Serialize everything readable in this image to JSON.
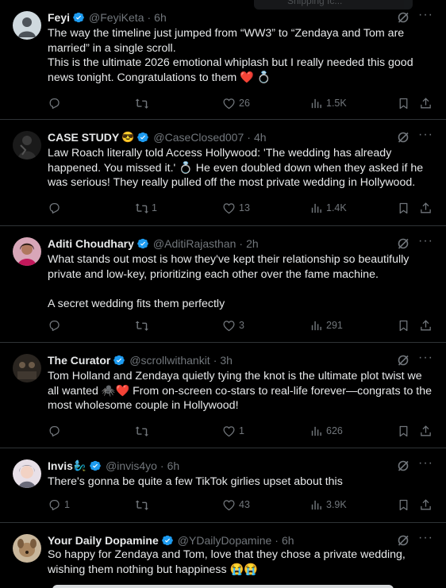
{
  "colors": {
    "background": "#000000",
    "text": "#e7e9ea",
    "muted": "#71767b",
    "verified": "#1d9bf0",
    "divider": "#2f3336",
    "heart_emoji": "#e0245e"
  },
  "top_overlay": {
    "text": "Shipping Ic..."
  },
  "tweets": [
    {
      "name": "Feyi",
      "name_emoji": "",
      "handle": "@FeyiKeta",
      "time": "6h",
      "text_lines": [
        "The way the timeline just jumped from “WW3” to “Zendaya and Tom are married” in a single scroll.",
        "This is the ultimate 2026 emotional whiplash but I really needed this good news tonight. Congratulations to them ❤️ 💍"
      ],
      "replies": "",
      "reposts": "",
      "likes": "26",
      "views": "1.5K",
      "avatar_icon": "default-profile-avatar"
    },
    {
      "name": "CASE STUDY",
      "name_emoji": "😎",
      "handle": "@CaseClosed007",
      "time": "4h",
      "text_lines": [
        "Law Roach literally told Access Hollywood: 'The wedding has already happened. You missed it.' 💍 He even doubled down when they asked if he was serious! They really pulled off the most private wedding in Hollywood."
      ],
      "replies": "",
      "reposts": "1",
      "likes": "13",
      "views": "1.4K",
      "avatar_icon": "dark-figure-avatar"
    },
    {
      "name": "Aditi Choudhary",
      "name_emoji": "",
      "handle": "@AditiRajasthan",
      "time": "2h",
      "text_lines": [
        "What stands out most is how they've kept their relationship so beautifully private and low-key, prioritizing each other over the fame machine.",
        "",
        "A secret wedding fits them perfectly"
      ],
      "replies": "",
      "reposts": "",
      "likes": "3",
      "views": "291",
      "avatar_icon": "woman-avatar"
    },
    {
      "name": "The Curator",
      "name_emoji": "",
      "handle": "@scrollwithankit",
      "time": "3h",
      "text_lines": [
        "Tom Holland and Zendaya quietly tying the knot is the ultimate plot twist we all wanted 🕷️❤️ From on-screen co-stars to real-life forever—congrats to the most wholesome couple in Hollywood!"
      ],
      "replies": "",
      "reposts": "",
      "likes": "1",
      "views": "626",
      "avatar_icon": "curator-avatar"
    },
    {
      "name": "Invis",
      "name_emoji": "🧞‍♂️",
      "handle": "@invis4yo",
      "time": "6h",
      "text_lines": [
        "There's gonna be quite a few TikTok girlies upset about this"
      ],
      "replies": "1",
      "reposts": "",
      "likes": "43",
      "views": "3.9K",
      "avatar_icon": "anime-avatar"
    },
    {
      "name": "Your Daily Dopamine",
      "name_emoji": "",
      "handle": "@YDailyDopamine",
      "time": "6h",
      "text_lines": [
        "So happy for Zendaya and Tom, love that they chose a private wedding, wishing them nothing but happiness 😭😭"
      ],
      "replies": "",
      "reposts": "",
      "likes": "",
      "views": "",
      "avatar_icon": "dog-avatar"
    }
  ]
}
